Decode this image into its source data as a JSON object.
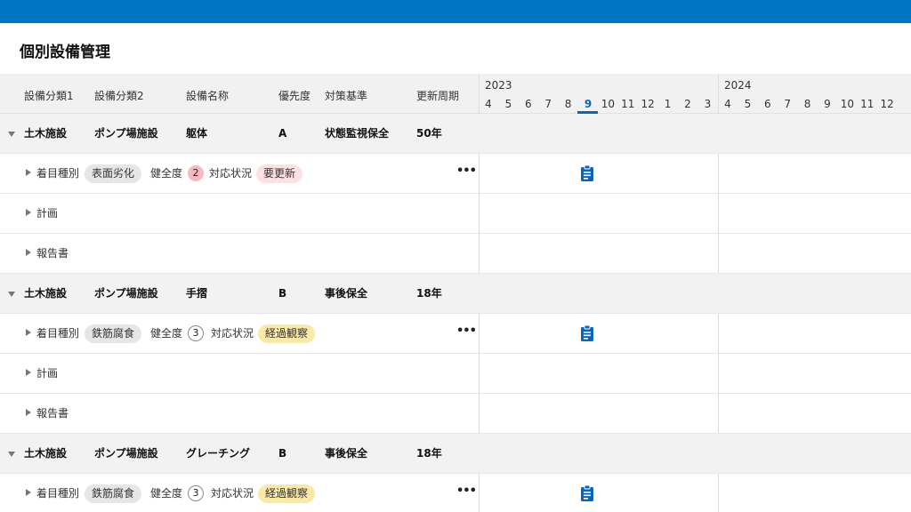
{
  "app": {
    "title": "個別設備管理",
    "accent": "#0075c2"
  },
  "columns": [
    "設備分類1",
    "設備分類2",
    "設備名称",
    "優先度",
    "対策基準",
    "更新周期"
  ],
  "timeline": {
    "years": [
      "2023",
      "2024"
    ],
    "months_2023": [
      "4",
      "5",
      "6",
      "7",
      "8",
      "9",
      "10",
      "11",
      "12",
      "1",
      "2",
      "3"
    ],
    "months_2024": [
      "4",
      "5",
      "6",
      "7",
      "8",
      "9",
      "10",
      "11",
      "12"
    ],
    "current_month": "9"
  },
  "groups": [
    {
      "cat1": "土木施設",
      "cat2": "ポンプ場施設",
      "name": "躯体",
      "priority": "A",
      "standard": "状態監視保全",
      "cycle": "50年",
      "detail": {
        "label": "着目種別",
        "type": "表面劣化",
        "health_label": "健全度",
        "health": "2",
        "status_label": "対応状況",
        "status": "要更新",
        "status_color": "#fde0e3"
      },
      "plan_label": "計画",
      "report_label": "報告書",
      "menu": "•••",
      "icon": "clipboard-icon"
    },
    {
      "cat1": "土木施設",
      "cat2": "ポンプ場施設",
      "name": "手摺",
      "priority": "B",
      "standard": "事後保全",
      "cycle": "18年",
      "detail": {
        "label": "着目種別",
        "type": "鉄筋腐食",
        "health_label": "健全度",
        "health": "3",
        "status_label": "対応状況",
        "status": "経過観察",
        "status_color": "#fbe9a6"
      },
      "plan_label": "計画",
      "report_label": "報告書",
      "menu": "•••",
      "icon": "clipboard-icon"
    },
    {
      "cat1": "土木施設",
      "cat2": "ポンプ場施設",
      "name": "グレーチング",
      "priority": "B",
      "standard": "事後保全",
      "cycle": "18年",
      "detail": {
        "label": "着目種別",
        "type": "鉄筋腐食",
        "health_label": "健全度",
        "health": "3",
        "status_label": "対応状況",
        "status": "経過観察",
        "status_color": "#fbe9a6"
      },
      "menu": "•••",
      "icon": "clipboard-icon"
    }
  ]
}
